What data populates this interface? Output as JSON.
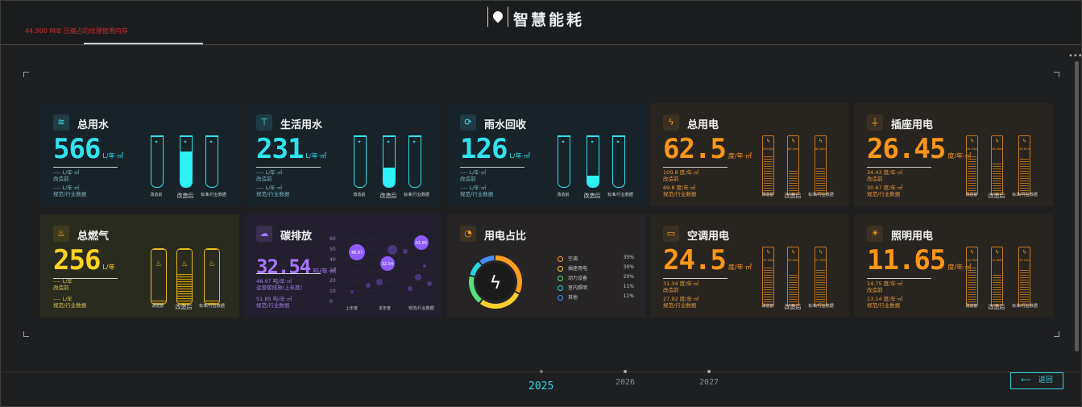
{
  "header": {
    "title": "智慧能耗",
    "notice": "44.900 MiB 压缩占的纹理使用内存",
    "menu_dots": "•••"
  },
  "cards": {
    "water_total": {
      "title": "总用水",
      "value": "566",
      "unit": "L/年·㎡",
      "line1": "---- L/年·㎡",
      "line2": "改造前",
      "line3": "---- L/年·㎡",
      "line4": "规范/行业数据",
      "tubes": [
        {
          "label": "改造前",
          "level": 0
        },
        {
          "label": "改造后",
          "level": 0.68
        },
        {
          "label": "标准/行业数据",
          "level": 0
        }
      ]
    },
    "water_living": {
      "title": "生活用水",
      "value": "231",
      "unit": "L/年·㎡",
      "line1": "---- L/年·㎡",
      "line2": "改造前",
      "line3": "---- L/年·㎡",
      "line4": "规范/行业数据",
      "tubes": [
        {
          "label": "改造前",
          "level": 0
        },
        {
          "label": "改造后",
          "level": 0.38
        },
        {
          "label": "标准/行业数据",
          "level": 0
        }
      ]
    },
    "water_rain": {
      "title": "雨水回收",
      "value": "126",
      "unit": "L/年·㎡",
      "line1": "---- L/年·㎡",
      "line2": "改造前",
      "line3": "---- L/年·㎡",
      "line4": "规范/行业数据",
      "tubes": [
        {
          "label": "改造前",
          "level": 0
        },
        {
          "label": "改造后",
          "level": 0.22
        },
        {
          "label": "标准/行业数据",
          "level": 0
        }
      ]
    },
    "elec_total": {
      "title": "总用电",
      "value": "62.5",
      "unit": "度/年·㎡",
      "line1": "100.8 度/年·㎡",
      "line2": "改造前",
      "line3": "69.8 度/年·㎡",
      "line4": "规范/行业数据",
      "bars": [
        {
          "label": "改造前",
          "value": "100.8/m²",
          "level": 1.0
        },
        {
          "label": "改造后",
          "value": "62.5/m²",
          "level": 0.62
        },
        {
          "label": "标准/行业数据",
          "value": "69.8/m²",
          "level": 0.69
        }
      ]
    },
    "elec_socket": {
      "title": "插座用电",
      "value": "26.45",
      "unit": "度/年·㎡",
      "line1": "34.43 度/年·㎡",
      "line2": "改造前",
      "line3": "30.67 度/年·㎡",
      "line4": "规范/行业数据",
      "bars": [
        {
          "label": "改造前",
          "value": "34.43/m²",
          "level": 1.0
        },
        {
          "label": "改造后",
          "value": "26.45/m²",
          "level": 0.77
        },
        {
          "label": "标准/行业数据",
          "value": "30.67/m²",
          "level": 0.89
        }
      ]
    },
    "gas_total": {
      "title": "总燃气",
      "value": "256",
      "unit": "L/年",
      "line1": "---- L/年",
      "line2": "改造前",
      "line3": "---- L/年",
      "line4": "规范/行业数据",
      "cans": [
        {
          "label": "改造前",
          "level": 0.08
        },
        {
          "label": "改造后",
          "level": 0.55
        },
        {
          "label": "标准/行业数据",
          "level": 0.08
        }
      ]
    },
    "carbon": {
      "title": "碳排放",
      "value": "32.54",
      "unit": "吨/年·㎡",
      "line1": "48.97 吨/年·㎡",
      "line2": "运营碳排放(上年度)",
      "line3": "51.85 吨/年·㎡",
      "line4": "规范/行业数据",
      "y_ticks": [
        "60",
        "50",
        "40",
        "30",
        "20",
        "10",
        "0"
      ],
      "x_labels": [
        "上年度",
        "本年度",
        "规范/行业数据"
      ],
      "bubbles": [
        "48.97",
        "32.54",
        "51.85"
      ]
    },
    "ratio": {
      "title": "用电占比",
      "legend": [
        {
          "name": "空调",
          "pct": "35%",
          "color": "#ff9d1f"
        },
        {
          "name": "插座用电",
          "pct": "30%",
          "color": "#ffcf2e"
        },
        {
          "name": "动力设备",
          "pct": "20%",
          "color": "#56e07a"
        },
        {
          "name": "室内照明",
          "pct": "11%",
          "color": "#2fd5de"
        },
        {
          "name": "其他",
          "pct": "11%",
          "color": "#4a8cff"
        }
      ]
    },
    "elec_ac": {
      "title": "空调用电",
      "value": "24.5",
      "unit": "度/年·㎡",
      "line1": "31.34 度/年·㎡",
      "line2": "改造前",
      "line3": "27.92 度/年·㎡",
      "line4": "规范/行业数据",
      "bars": [
        {
          "label": "改造前",
          "value": "31.34/m²",
          "level": 1.0
        },
        {
          "label": "改造后",
          "value": "24.5/m²",
          "level": 0.78
        },
        {
          "label": "标准/行业数据",
          "value": "27.92/m²",
          "level": 0.89
        }
      ]
    },
    "elec_light": {
      "title": "照明用电",
      "value": "11.65",
      "unit": "度/年·㎡",
      "line1": "14.75 度/年·㎡",
      "line2": "改造前",
      "line3": "13.14 度/年·㎡",
      "line4": "规范/行业数据",
      "bars": [
        {
          "label": "改造前",
          "value": "14.75/m²",
          "level": 1.0
        },
        {
          "label": "改造后",
          "value": "11.65/m²",
          "level": 0.79
        },
        {
          "label": "标准/行业数据",
          "value": "13.14/m²",
          "level": 0.89
        }
      ]
    }
  },
  "timeline": {
    "years": [
      "2025",
      "2026",
      "2027"
    ],
    "active": "2025"
  },
  "back_button": {
    "arrow": "⟵",
    "label": "返回"
  },
  "colors": {
    "water": "#2fe3ee",
    "elec": "#ff9619",
    "gas": "#ffd21f",
    "carbon": "#a676ff"
  }
}
